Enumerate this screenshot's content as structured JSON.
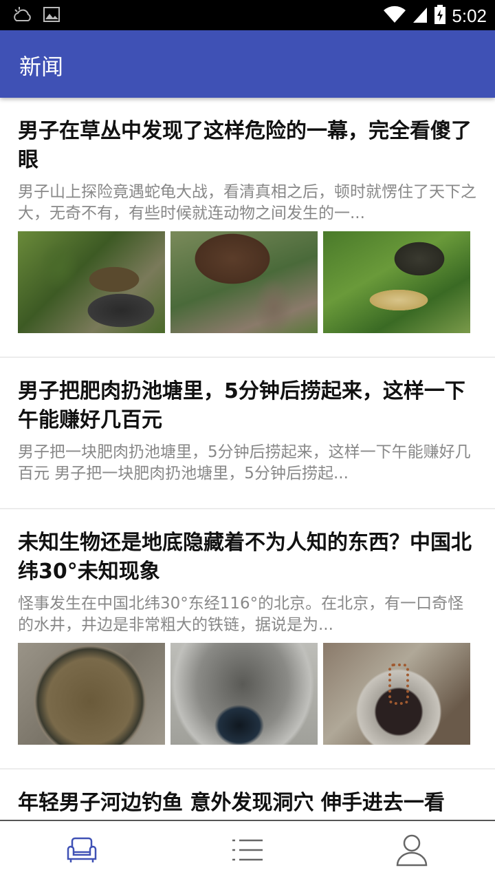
{
  "status_bar": {
    "time": "5:02",
    "icons": [
      "weather-icon",
      "image-icon",
      "wifi-icon",
      "signal-icon",
      "battery-icon"
    ]
  },
  "app_bar": {
    "title": "新闻",
    "color": "#3f51b5"
  },
  "articles": [
    {
      "title": "男子在草丛中发现了这样危险的一幕，完全看傻了眼",
      "summary": "男子山上探险竟遇蛇龟大战，看清真相之后，顿时就愣住了天下之大，无奇不有，有些时候就连动物之间发生的一...",
      "images": [
        "snake-turtle-photo-1",
        "snake-turtle-photo-2",
        "snake-turtle-photo-3"
      ]
    },
    {
      "title": "男子把肥肉扔池塘里，5分钟后捞起来，这样一下午能赚好几百元",
      "summary": "男子把一块肥肉扔池塘里，5分钟后捞起来，这样一下午能赚好几百元 男子把一块肥肉扔池塘里，5分钟后捞起..."
    },
    {
      "title": "未知生物还是地底隐藏着不为人知的东西？中国北纬30°未知现象",
      "summary": "怪事发生在中国北纬30°东经116°的北京。在北京，有一口奇怪的水井，井边是非常粗大的铁链，据说是为...",
      "images": [
        "well-cover-photo",
        "well-interior-photo",
        "well-chain-photo"
      ]
    },
    {
      "title": "年轻男子河边钓鱼 意外发现洞穴 伸手进去一看"
    }
  ],
  "bottom_nav": {
    "items": [
      "home-sofa-icon",
      "list-menu-icon",
      "user-profile-icon"
    ],
    "active_color": "#3f51b5",
    "inactive_color": "#666666"
  }
}
